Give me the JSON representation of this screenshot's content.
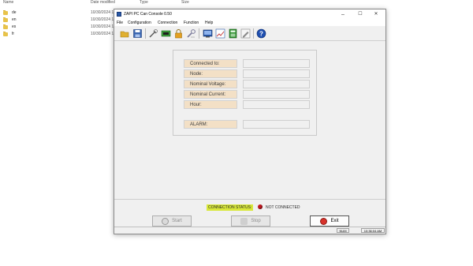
{
  "explorer": {
    "headers": {
      "name": "Name",
      "date": "Date modified",
      "type": "Type",
      "size": "Size"
    },
    "folders": [
      {
        "name": "de",
        "date": "10/30/2024 1"
      },
      {
        "name": "en",
        "date": "10/30/2024 1"
      },
      {
        "name": "es",
        "date": "10/30/2024 1"
      },
      {
        "name": "fr",
        "date": "10/30/2024 1"
      }
    ]
  },
  "window": {
    "title": "ZAPI PC Can Console 0.50",
    "controls": {
      "minimize": "–",
      "maximize": "☐",
      "close": "✕"
    },
    "menu": [
      "File",
      "Configuration",
      "Connection",
      "Function",
      "Help"
    ],
    "toolbar_icons": [
      {
        "name": "open-folder-icon",
        "color": "#e0b030"
      },
      {
        "name": "save-disk-icon",
        "color": "#3a66b0"
      },
      {
        "name": "tools-icon",
        "color": "#6a6a6a"
      },
      {
        "name": "battery-icon",
        "color": "#3a9a3a"
      },
      {
        "name": "lock-icon",
        "color": "#e4a020"
      },
      {
        "name": "wrench-icon",
        "color": "#7a7a9a"
      },
      {
        "name": "monitor-icon",
        "color": "#2a5aa8"
      },
      {
        "name": "chart-icon",
        "color": "#b04040"
      },
      {
        "name": "calculator-icon",
        "color": "#2f8f2f"
      },
      {
        "name": "pen-icon",
        "color": "#8a8a8a"
      },
      {
        "name": "help-icon",
        "color": "#1f4fb0"
      }
    ]
  },
  "info": {
    "fields": [
      {
        "label": "Connected to:",
        "value": ""
      },
      {
        "label": "Node:",
        "value": ""
      },
      {
        "label": "Nominal Voltage:",
        "value": ""
      },
      {
        "label": "Nominal Current:",
        "value": ""
      },
      {
        "label": "Hour:",
        "value": ""
      }
    ],
    "alarm": {
      "label": "ALARM:",
      "value": ""
    }
  },
  "status": {
    "connection_label": "CONNECTION STATUS:",
    "connection_value": "NOT CONNECTED",
    "led_color": "#c0171e"
  },
  "buttons": {
    "start": "Start",
    "stop": "Stop",
    "exit": "Exit"
  },
  "statusbar": {
    "num": "NUM",
    "time": "10:36:04 AM"
  }
}
